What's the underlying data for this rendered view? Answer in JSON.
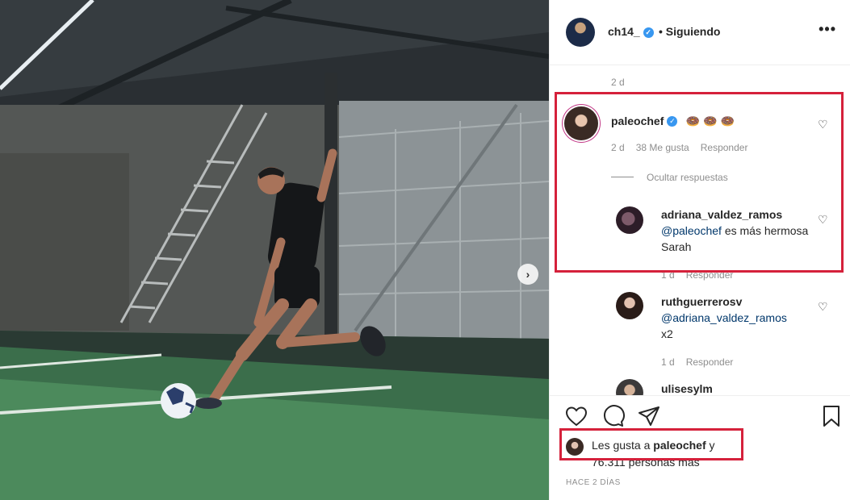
{
  "post": {
    "username": "ch14_",
    "verified_mark": "✓",
    "follow_status": "• Siguiendo",
    "more_icon": "more-icon",
    "caption_time": "2 d"
  },
  "comments": [
    {
      "username": "paleochef",
      "verified_mark": "✓",
      "text": "🍩 🍩 🍩",
      "time": "2 d",
      "likes": "38 Me gusta",
      "reply": "Responder",
      "toggle_replies": "Ocultar respuestas",
      "replies": [
        {
          "username": "adriana_valdez_ramos",
          "mention": "@paleochef",
          "text": " es más hermosa Sarah",
          "time": "1 d",
          "reply": "Responder"
        },
        {
          "username": "ruthguerrerosv",
          "mention": "@adriana_valdez_ramos",
          "text": "x2",
          "time": "1 d",
          "reply": "Responder"
        },
        {
          "username": "ulisesylm"
        }
      ]
    }
  ],
  "likes_summary": {
    "line1_prefix": "Les gusta a ",
    "line1_user": "paleochef",
    "line1_suffix": " y",
    "line2": "76.311 personas más"
  },
  "post_age": "HACE 2 DÍAS",
  "colors": {
    "highlight_box": "#d5213b",
    "verified": "#3897f0",
    "mention": "#00376b"
  }
}
